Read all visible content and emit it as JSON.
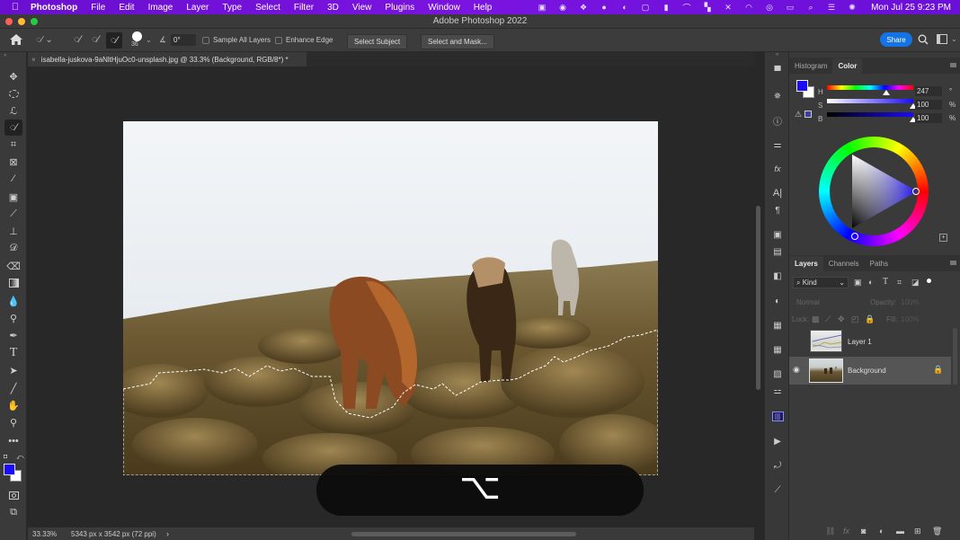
{
  "menubar": {
    "apple": "",
    "app_name": "Photoshop",
    "items": [
      "File",
      "Edit",
      "Image",
      "Layer",
      "Type",
      "Select",
      "Filter",
      "3D",
      "View",
      "Plugins",
      "Window",
      "Help"
    ],
    "status_icons": [
      "screen-record-icon",
      "creative-cloud-icon",
      "dropbox-icon",
      "globe-icon",
      "music-icon",
      "screen-mirror-icon",
      "bookmark-icon",
      "arc-icon",
      "grid-icon",
      "bluetooth-icon",
      "wifi-icon",
      "user-icon",
      "battery-icon",
      "search-icon",
      "control-center-icon",
      "siri-icon"
    ],
    "clock": "Mon Jul 25  9:23 PM"
  },
  "titlebar": {
    "title": "Adobe Photoshop 2022"
  },
  "options": {
    "brush_size": "36",
    "angle": "0°",
    "sample_all_layers": "Sample All Layers",
    "enhance_edge": "Enhance Edge",
    "select_subject": "Select Subject",
    "select_and_mask": "Select and Mask...",
    "share": "Share"
  },
  "document": {
    "tab_title": "isabella-juskova-9aNltHjuOc0-unsplash.jpg @ 33.3% (Background, RGB/8*) *"
  },
  "toolbar": {
    "tools": [
      "move",
      "marquee",
      "lasso",
      "quick-selection",
      "crop",
      "frame",
      "eyedropper",
      "spot-healing",
      "brush",
      "clone-stamp",
      "history-brush",
      "eraser",
      "gradient",
      "blur",
      "dodge",
      "pen",
      "type",
      "path-selection",
      "line",
      "hand",
      "zoom",
      "more",
      "quick-mask",
      "screen-mode"
    ],
    "foreground_color": "#1a0cf5",
    "background_color": "#ffffff"
  },
  "color_panel": {
    "tabs": [
      "Histogram",
      "Color"
    ],
    "active_tab": "Color",
    "h_label": "H",
    "h_value": "247",
    "h_unit": "°",
    "s_label": "S",
    "s_value": "100",
    "s_unit": "%",
    "b_label": "B",
    "b_value": "100",
    "b_unit": "%",
    "hue_fraction": 0.686,
    "saturation_fraction": 1.0,
    "brightness_fraction": 1.0
  },
  "layers_panel": {
    "tabs": [
      "Layers",
      "Channels",
      "Paths"
    ],
    "active_tab": "Layers",
    "filter_label": "Kind",
    "blend_mode": "Normal",
    "opacity_label": "Opacity:",
    "opacity_value": "100%",
    "lock_label": "Lock:",
    "fill_label": "Fill:",
    "fill_value": "100%",
    "layers": [
      {
        "name": "Layer 1",
        "visible": false,
        "locked": false,
        "selected": false
      },
      {
        "name": "Background",
        "visible": true,
        "locked": true,
        "selected": true
      }
    ]
  },
  "status": {
    "zoom": "33.33%",
    "doc_info": "5343 px x 3542 px (72 ppi)",
    "arrow": "›"
  },
  "hud": {
    "key_symbol": "⌥"
  }
}
